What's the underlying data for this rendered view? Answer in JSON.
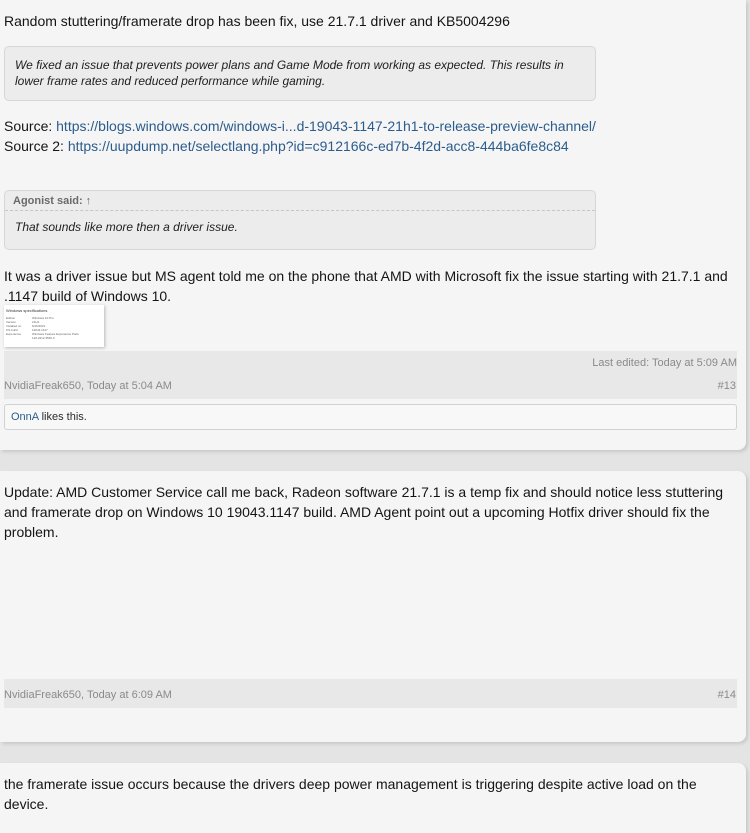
{
  "post1": {
    "intro": "Random stuttering/framerate drop has been fix, use 21.7.1 driver and KB5004296",
    "quote1": "We fixed an issue that prevents power plans and Game Mode from working as expected. This results in lower frame rates and reduced performance while gaming.",
    "source_label": "Source: ",
    "source_link": "https://blogs.windows.com/windows-i...d-19043-1147-21h1-to-release-preview-channel/",
    "source2_label": "Source 2: ",
    "source2_link": "https://uupdump.net/selectlang.php?id=c912166c-ed7b-4f2d-acc8-444ba6fe8c84",
    "quote2_author": "Agonist said:",
    "quote2_arrow": "↑",
    "quote2_text": "That sounds like more then a driver issue.",
    "reply": "It was a driver issue but MS agent told me on the phone that AMD with Microsoft fix the issue starting with 21.7.1 and .1147 build of Windows 10.",
    "thumb": {
      "title": "Windows specifications",
      "rows": [
        {
          "k": "Edition",
          "v": "Windows 10 Pro"
        },
        {
          "k": "Version",
          "v": "21H1"
        },
        {
          "k": "Installed on",
          "v": "6/16/2021"
        },
        {
          "k": "OS build",
          "v": "19043.1147"
        },
        {
          "k": "Experience",
          "v": "Windows Feature Experience Pack 120.2212.3530.0"
        }
      ]
    },
    "last_edited": "Last edited: Today at 5:09 AM",
    "author_time": "NvidiaFreak650, Today at 5:04 AM",
    "post_number": "#13",
    "likes_user": "OnnA",
    "likes_text": " likes this."
  },
  "post2": {
    "text": "Update: AMD Customer Service call me back, Radeon software 21.7.1 is a temp fix and should notice less stuttering and framerate drop on Windows 10 19043.1147 build. AMD Agent point out a upcoming Hotfix driver should fix the problem.",
    "author_time": "NvidiaFreak650, Today at 6:09 AM",
    "post_number": "#14"
  },
  "post3": {
    "text": "the framerate issue occurs because the drivers deep power management is triggering despite active load on the device."
  }
}
